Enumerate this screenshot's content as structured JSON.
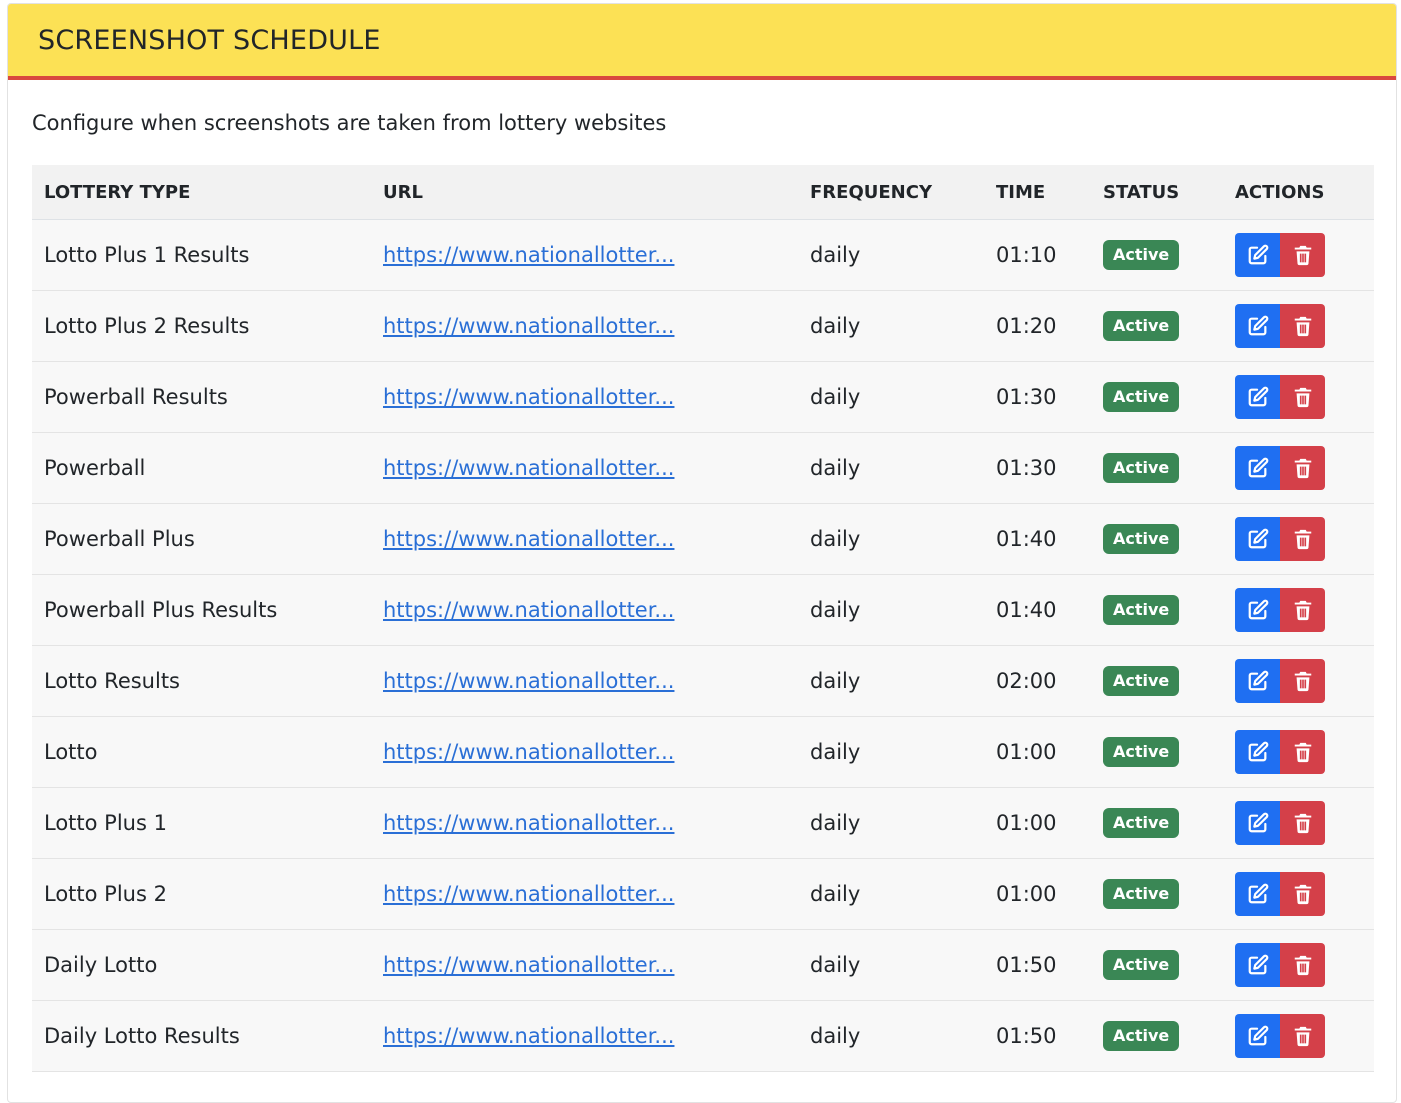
{
  "header": {
    "title": "SCREENSHOT SCHEDULE"
  },
  "description": "Configure when screenshots are taken from lottery websites",
  "table": {
    "columns": [
      "LOTTERY TYPE",
      "URL",
      "FREQUENCY",
      "TIME",
      "STATUS",
      "ACTIONS"
    ],
    "rows": [
      {
        "type": "Lotto Plus 1 Results",
        "url": "https://www.nationallotter...",
        "frequency": "daily",
        "time": "01:10",
        "status": "Active"
      },
      {
        "type": "Lotto Plus 2 Results",
        "url": "https://www.nationallotter...",
        "frequency": "daily",
        "time": "01:20",
        "status": "Active"
      },
      {
        "type": "Powerball Results",
        "url": "https://www.nationallotter...",
        "frequency": "daily",
        "time": "01:30",
        "status": "Active"
      },
      {
        "type": "Powerball",
        "url": "https://www.nationallotter...",
        "frequency": "daily",
        "time": "01:30",
        "status": "Active"
      },
      {
        "type": "Powerball Plus",
        "url": "https://www.nationallotter...",
        "frequency": "daily",
        "time": "01:40",
        "status": "Active"
      },
      {
        "type": "Powerball Plus Results",
        "url": "https://www.nationallotter...",
        "frequency": "daily",
        "time": "01:40",
        "status": "Active"
      },
      {
        "type": "Lotto Results",
        "url": "https://www.nationallotter...",
        "frequency": "daily",
        "time": "02:00",
        "status": "Active"
      },
      {
        "type": "Lotto",
        "url": "https://www.nationallotter...",
        "frequency": "daily",
        "time": "01:00",
        "status": "Active"
      },
      {
        "type": "Lotto Plus 1",
        "url": "https://www.nationallotter...",
        "frequency": "daily",
        "time": "01:00",
        "status": "Active"
      },
      {
        "type": "Lotto Plus 2",
        "url": "https://www.nationallotter...",
        "frequency": "daily",
        "time": "01:00",
        "status": "Active"
      },
      {
        "type": "Daily Lotto",
        "url": "https://www.nationallotter...",
        "frequency": "daily",
        "time": "01:50",
        "status": "Active"
      },
      {
        "type": "Daily Lotto Results",
        "url": "https://www.nationallotter...",
        "frequency": "daily",
        "time": "01:50",
        "status": "Active"
      }
    ]
  },
  "icons": {
    "edit": "edit-icon",
    "delete": "trash-icon"
  },
  "colors": {
    "header_bg": "#fce155",
    "header_border": "#d9473e",
    "status_active": "#3a8755",
    "edit_button": "#1f6ff2",
    "delete_button": "#d44049",
    "link": "#2a6fd6"
  }
}
